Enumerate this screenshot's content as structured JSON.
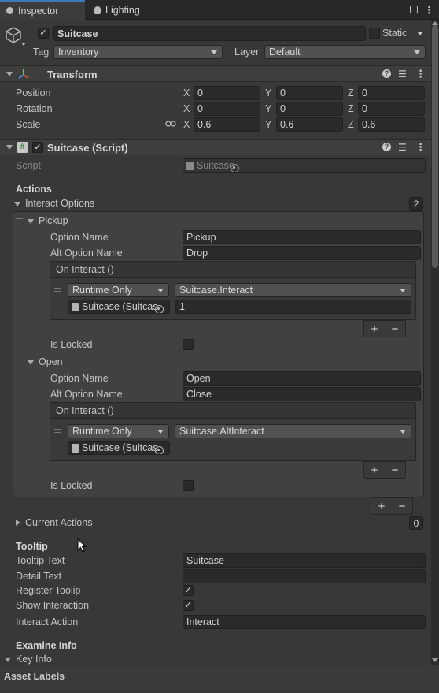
{
  "tabs": [
    {
      "label": "Inspector"
    },
    {
      "label": "Lighting"
    }
  ],
  "object": {
    "name": "Suitcase",
    "active": true,
    "static_label": "Static",
    "static": false,
    "tag_label": "Tag",
    "tag_value": "Inventory",
    "layer_label": "Layer",
    "layer_value": "Default"
  },
  "transform": {
    "title": "Transform",
    "rows": [
      {
        "label": "Position",
        "x": "0",
        "y": "0",
        "z": "0"
      },
      {
        "label": "Rotation",
        "x": "0",
        "y": "0",
        "z": "0"
      },
      {
        "label": "Scale",
        "x": "0.6",
        "y": "0.6",
        "z": "0.6"
      }
    ],
    "axis": {
      "x": "X",
      "y": "Y",
      "z": "Z"
    }
  },
  "script_component": {
    "title": "Suitcase (Script)",
    "enabled": true,
    "script_label": "Script",
    "script_value": "Suitcase",
    "actions_header": "Actions",
    "interact_options_label": "Interact Options",
    "interact_options_count": "2",
    "options": [
      {
        "title": "Pickup",
        "option_name_label": "Option Name",
        "option_name": "Pickup",
        "alt_option_name_label": "Alt Option Name",
        "alt_option_name": "Drop",
        "event_header": "On Interact ()",
        "runtime": "Runtime Only",
        "function": "Suitcase.Interact",
        "object": "Suitcase (Suitcas",
        "argument": "1",
        "is_locked_label": "Is Locked",
        "is_locked": false
      },
      {
        "title": "Open",
        "option_name_label": "Option Name",
        "option_name": "Open",
        "alt_option_name_label": "Alt Option Name",
        "alt_option_name": "Close",
        "event_header": "On Interact ()",
        "runtime": "Runtime Only",
        "function": "Suitcase.AltInteract",
        "object": "Suitcase (Suitcas",
        "is_locked_label": "Is Locked",
        "is_locked": false
      }
    ],
    "current_actions_label": "Current Actions",
    "current_actions_count": "0",
    "tooltip_header": "Tooltip",
    "tooltip_text_label": "Tooltip Text",
    "tooltip_text": "Suitcase",
    "detail_text_label": "Detail Text",
    "detail_text": "",
    "register_tooltip_label": "Register Toolip",
    "register_tooltip": true,
    "show_interaction_label": "Show Interaction",
    "show_interaction": true,
    "interact_action_label": "Interact Action",
    "interact_action": "Interact",
    "examine_header": "Examine Info",
    "key_info_label": "Key Info"
  },
  "footer": {
    "label": "Asset Labels"
  },
  "plus_minus": {
    "plus": "+",
    "minus": "−"
  },
  "check_glyph": "✓"
}
